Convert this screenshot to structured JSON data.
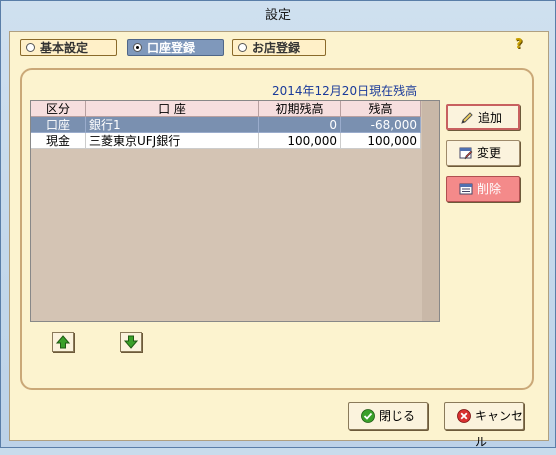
{
  "window": {
    "title": "設定"
  },
  "tabs": [
    {
      "label": "基本設定",
      "selected": false
    },
    {
      "label": "口座登録",
      "selected": true
    },
    {
      "label": "お店登録",
      "selected": false
    }
  ],
  "help_icon": "help-question-icon",
  "balance_date_label": "2014年12月20日現在残高",
  "table": {
    "headers": {
      "kubun": "区分",
      "account": "口 座",
      "initial": "初期残高",
      "balance": "残高"
    },
    "rows": [
      {
        "kubun": "口座",
        "account": "銀行1",
        "initial": "0",
        "balance": "-68,000",
        "selected": true
      },
      {
        "kubun": "現金",
        "account": "三菱東京UFJ銀行",
        "initial": "100,000",
        "balance": "100,000",
        "selected": false
      }
    ]
  },
  "actions": {
    "add": "追加",
    "edit": "変更",
    "delete": "削除"
  },
  "footer": {
    "close": "閉じる",
    "cancel": "キャンセル"
  },
  "colors": {
    "selected_row": "#7a90b0",
    "header_bg": "#f6dede",
    "panel_bg": "#fcf3cf",
    "delete_button": "#f48a8a"
  }
}
